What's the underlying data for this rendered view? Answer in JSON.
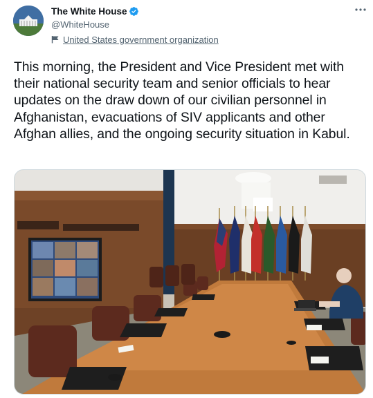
{
  "author": {
    "name": "The White House",
    "handle": "@WhiteHouse",
    "verified": true,
    "label": "United States government organization",
    "avatar_icon": "white-house-avatar-icon",
    "verified_icon": "verified-badge-icon",
    "label_icon": "flag-icon"
  },
  "menu": {
    "icon": "more-icon"
  },
  "tweet": {
    "text": "This morning, the President and Vice President met with their national security team and senior officials to hear updates on the draw down of our civilian personnel in Afghanistan, evacuations of SIV applicants and other Afghan allies, and the ongoing security situation in Kabul."
  },
  "media": {
    "type": "photo",
    "icon": "situation-room-photo"
  },
  "colors": {
    "verified": "#1d9bf0",
    "text": "#0f1419",
    "secondary": "#536471"
  }
}
